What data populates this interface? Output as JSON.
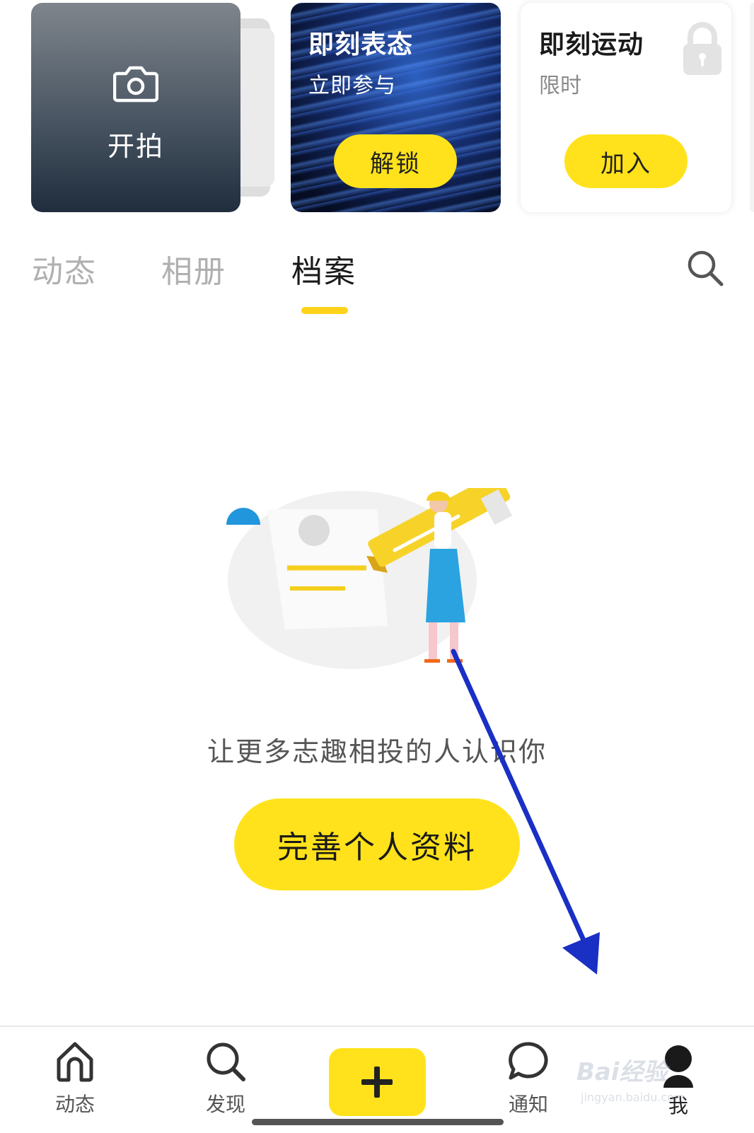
{
  "cards": {
    "shoot": {
      "label": "开拍",
      "icon": "camera-icon"
    },
    "express": {
      "title": "即刻表态",
      "subtitle": "立即参与",
      "button": "解锁"
    },
    "sport": {
      "title": "即刻运动",
      "subtitle": "限时",
      "button": "加入",
      "icon": "lock-icon"
    }
  },
  "tabs": [
    {
      "label": "动态",
      "active": false
    },
    {
      "label": "相册",
      "active": false
    },
    {
      "label": "档案",
      "active": true
    }
  ],
  "search": {
    "icon": "search-icon"
  },
  "empty_state": {
    "message": "让更多志趣相投的人认识你",
    "button": "完善个人资料"
  },
  "bottom_nav": [
    {
      "label": "动态",
      "icon": "home-icon"
    },
    {
      "label": "发现",
      "icon": "search-icon"
    },
    {
      "label": "",
      "icon": "plus-icon"
    },
    {
      "label": "通知",
      "icon": "chat-bubble-icon"
    },
    {
      "label": "我",
      "icon": "avatar-icon"
    }
  ],
  "watermark": {
    "text": "Bai经验",
    "url": "jingyan.baidu.com"
  },
  "colors": {
    "accent_yellow": "#ffe21b",
    "annotation_blue": "#1a2fc4",
    "tab_inactive": "#b0b0b0",
    "text_dark": "#1a1a1a"
  }
}
